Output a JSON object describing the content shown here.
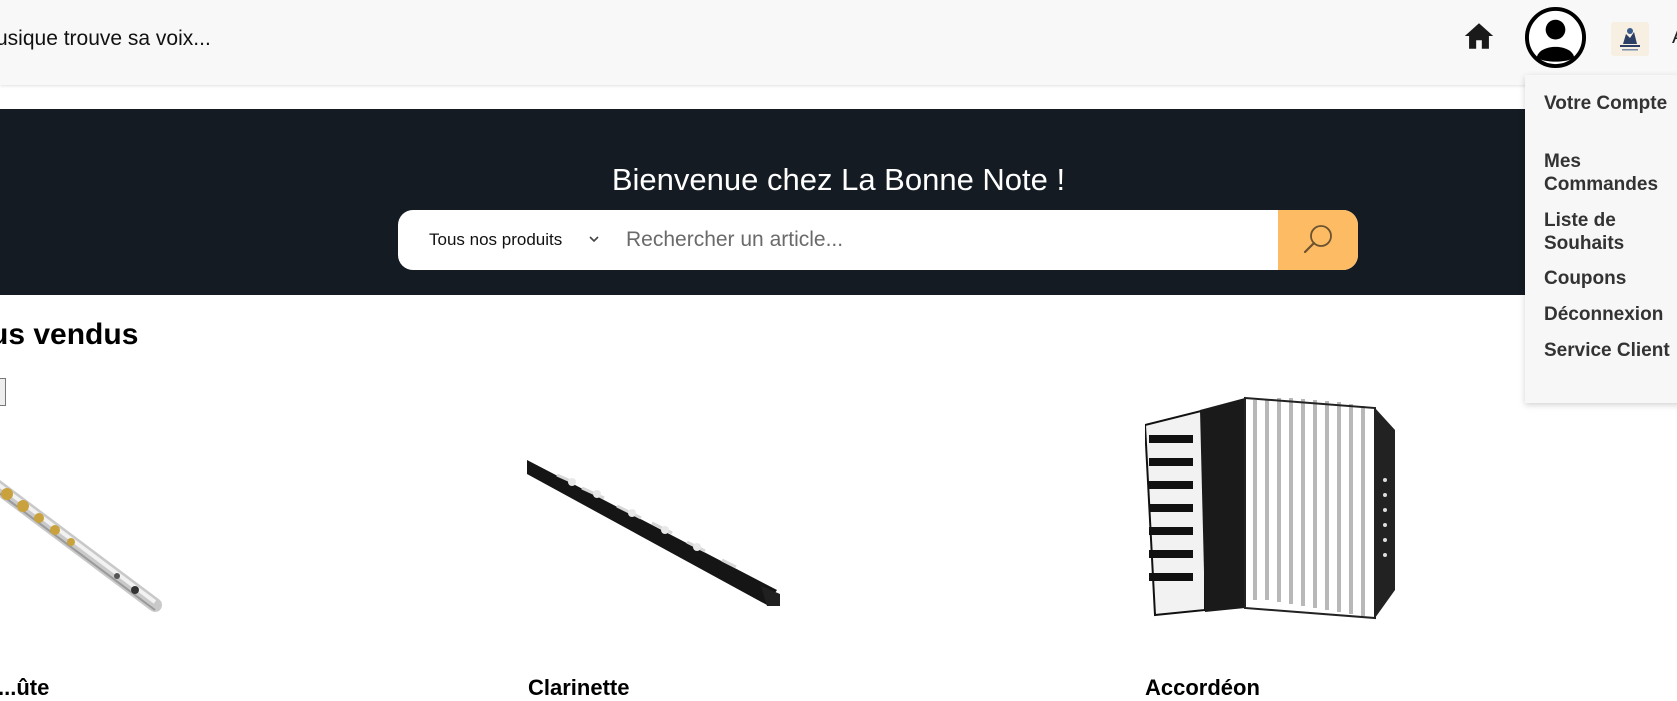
{
  "header": {
    "tagline": "usique trouve sa voix...",
    "home_icon": "home-icon",
    "account_icon": "user-circle-icon",
    "logo": "brand-logo",
    "edge_glyph": "A"
  },
  "account_menu": {
    "items": [
      {
        "label": "Votre Compte"
      },
      {
        "label": "Mes Commandes"
      },
      {
        "label": "Liste de Souhaits"
      },
      {
        "label": "Coupons"
      },
      {
        "label": "Déconnexion"
      },
      {
        "label": "Service Client"
      }
    ]
  },
  "hero": {
    "title": "Bienvenue chez La Bonne Note !",
    "category_selected": "Tous nos produits",
    "search_placeholder": "Rechercher un article...",
    "search_icon": "search-icon"
  },
  "colors": {
    "hero_bg": "#141b23",
    "search_button": "#fdbb63",
    "header_bg": "#f8f8f8"
  },
  "best_sellers": {
    "title": "us vendus",
    "products": [
      {
        "image": "flute-image",
        "name": "...ûte"
      },
      {
        "image": "clarinet-image",
        "name": "Clarinette"
      },
      {
        "image": "accordion-image",
        "name": "Accordéon"
      }
    ]
  }
}
